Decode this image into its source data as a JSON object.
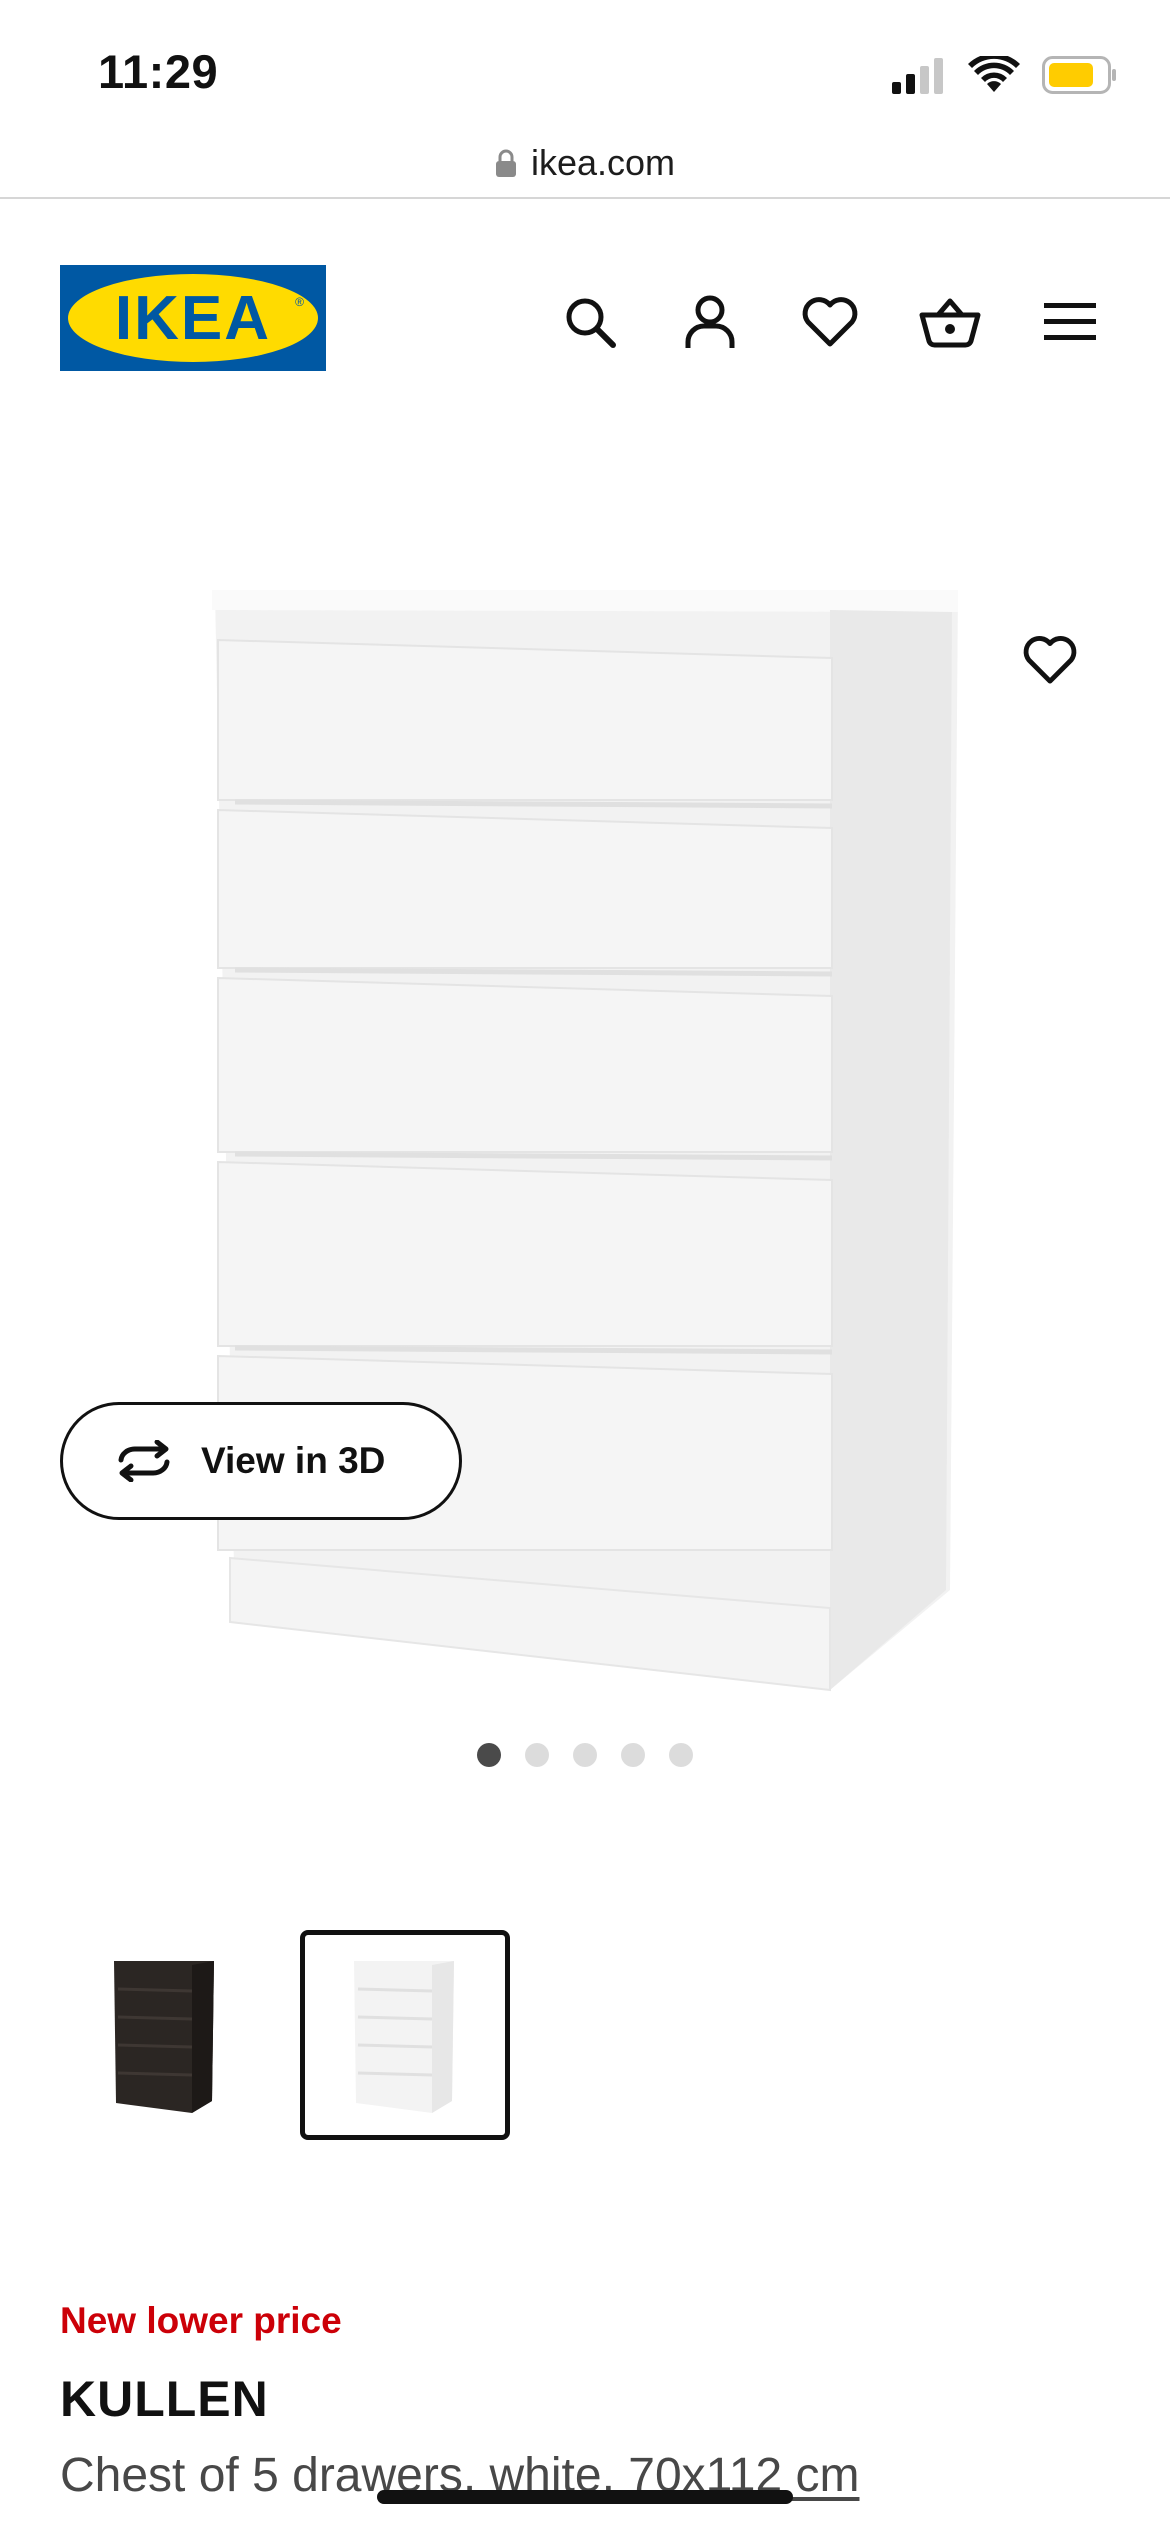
{
  "status_bar": {
    "time": "11:29",
    "icons": [
      "cellular-signal-icon",
      "wifi-icon",
      "battery-icon"
    ],
    "battery_color": "#ffcc00"
  },
  "browser": {
    "url": "ikea.com",
    "icon": "lock-icon"
  },
  "header": {
    "logo_text": "IKEA",
    "logo_colors": {
      "blue": "#0058a3",
      "yellow": "#ffdb00"
    },
    "nav_icons": [
      "search-icon",
      "user-icon",
      "heart-icon",
      "basket-icon",
      "menu-icon"
    ]
  },
  "gallery": {
    "view_3d_label": "View in 3D",
    "dot_count": 5,
    "active_dot": 1,
    "favorite_icon": "heart-icon"
  },
  "variants": [
    {
      "name": "black-brown",
      "color": "#2b2623",
      "selected": false
    },
    {
      "name": "white",
      "color": "#f3f3f3",
      "selected": true
    }
  ],
  "product": {
    "promo_label": "New lower price",
    "promo_color": "#cc0008",
    "name": "KULLEN",
    "description_prefix": "Chest of 5 drawers, white, ",
    "dimensions": "70x112 cm"
  }
}
